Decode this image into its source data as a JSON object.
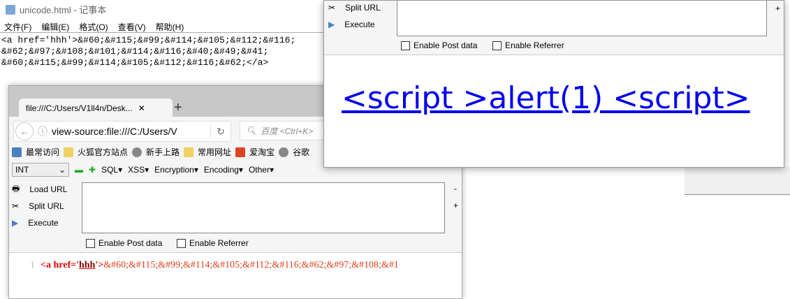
{
  "notepad": {
    "title": "unicode.html - 记事本",
    "menu": [
      "文件(F)",
      "编辑(E)",
      "格式(O)",
      "查看(V)",
      "帮助(H)"
    ],
    "lines": [
      "<a href='hhh'>&#60;&#115;&#99;&#114;&#105;&#112;&#116;",
      "&#62;&#97;&#108;&#101;&#114;&#116;&#40;&#49;&#41;",
      "&#60;&#115;&#99;&#114;&#105;&#112;&#116;&#62;</a>"
    ]
  },
  "browser": {
    "tab_title": "file:///C:/Users/V1ll4n/Desk...",
    "url": "view-source:file:///C:/Users/V",
    "search_placeholder": "百度 <Ctrl+K>",
    "bookmarks": [
      "最常访问",
      "火狐官方站点",
      "新手上路",
      "常用网址",
      "爱淘宝",
      "谷歌"
    ],
    "hackbar": {
      "select": "INT",
      "menus": [
        "SQL▾",
        "XSS▾",
        "Encryption▾",
        "Encoding▾",
        "Other▾"
      ],
      "load_url": "Load URL",
      "split_url": "Split URL",
      "execute": "Execute",
      "enable_post": "Enable Post data",
      "enable_referrer": "Enable Referrer",
      "minus": "-",
      "plus": "+"
    },
    "source": {
      "line_no": "1",
      "tag": "<a href='",
      "attr": "hhh",
      "tag_end": "'>",
      "text": "&#60;&#115;&#99;&#114;&#105;&#112;&#116;&#62;&#97;&#108;&#1"
    }
  },
  "front": {
    "split_url": "Split URL",
    "execute": "Execute",
    "enable_post": "Enable Post data",
    "enable_referrer": "Enable Referrer",
    "plus": "+",
    "link_text": "<script >alert(1) <script>"
  }
}
